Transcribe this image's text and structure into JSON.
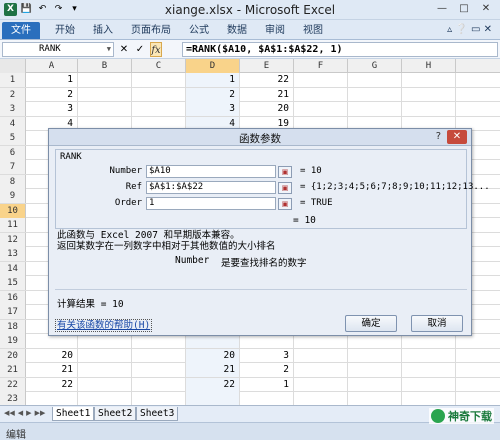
{
  "window": {
    "title": "xiange.xlsx - Microsoft Excel",
    "quick_access": [
      "X",
      "💾",
      "↶",
      "↷",
      "▾"
    ],
    "controls": [
      "—",
      "□",
      "✕"
    ]
  },
  "ribbon": {
    "tabs": [
      "文件",
      "开始",
      "插入",
      "页面布局",
      "公式",
      "数据",
      "审阅",
      "视图"
    ],
    "help": "▵ ❔ ▭ ✕"
  },
  "formula_bar": {
    "name_box": "RANK",
    "cancel": "✕",
    "enter": "✓",
    "fx": "fx",
    "formula": "=RANK($A10, $A$1:$A$22, 1)"
  },
  "columns": [
    "A",
    "B",
    "C",
    "D",
    "E",
    "F",
    "G",
    "H"
  ],
  "selected_column": "D",
  "selected_row": "10",
  "rows": [
    {
      "n": "1",
      "a": "1",
      "d": "1",
      "e": "22"
    },
    {
      "n": "2",
      "a": "2",
      "d": "2",
      "e": "21"
    },
    {
      "n": "3",
      "a": "3",
      "d": "3",
      "e": "20"
    },
    {
      "n": "4",
      "a": "4",
      "d": "4",
      "e": "19"
    },
    {
      "n": "5",
      "a": "",
      "d": "",
      "e": ""
    },
    {
      "n": "6",
      "a": "",
      "d": "",
      "e": ""
    },
    {
      "n": "7",
      "a": "",
      "d": "",
      "e": ""
    },
    {
      "n": "8",
      "a": "",
      "d": "",
      "e": ""
    },
    {
      "n": "9",
      "a": "",
      "d": "",
      "e": ""
    },
    {
      "n": "10",
      "a": "",
      "d": "",
      "e": ""
    },
    {
      "n": "11",
      "a": "",
      "d": "",
      "e": ""
    },
    {
      "n": "12",
      "a": "",
      "d": "",
      "e": ""
    },
    {
      "n": "13",
      "a": "",
      "d": "",
      "e": ""
    },
    {
      "n": "14",
      "a": "",
      "d": "",
      "e": ""
    },
    {
      "n": "15",
      "a": "",
      "d": "",
      "e": ""
    },
    {
      "n": "16",
      "a": "",
      "d": "",
      "e": ""
    },
    {
      "n": "17",
      "a": "",
      "d": "",
      "e": ""
    },
    {
      "n": "18",
      "a": "",
      "d": "",
      "e": ""
    },
    {
      "n": "19",
      "a": "",
      "d": "",
      "e": ""
    },
    {
      "n": "20",
      "a": "20",
      "d": "20",
      "e": "3"
    },
    {
      "n": "21",
      "a": "21",
      "d": "21",
      "e": "2"
    },
    {
      "n": "22",
      "a": "22",
      "d": "22",
      "e": "1"
    },
    {
      "n": "23",
      "a": "",
      "d": "",
      "e": ""
    }
  ],
  "sheets": [
    "Sheet1",
    "Sheet2",
    "Sheet3"
  ],
  "status": "编辑",
  "watermark": "神奇下载",
  "dialog": {
    "title": "函数参数",
    "help": "?",
    "close": "✕",
    "function_name": "RANK",
    "args": [
      {
        "label": "Number",
        "value": "$A10",
        "result": "= 10"
      },
      {
        "label": "Ref",
        "value": "$A$1:$A$22",
        "result": "= {1;2;3;4;5;6;7;8;9;10;11;12;13..."
      },
      {
        "label": "Order",
        "value": "1",
        "result": "= TRUE"
      }
    ],
    "overall_result": "= 10",
    "description_1": "此函数与 Excel 2007 和早期版本兼容。",
    "description_2": "返回某数字在一列数字中相对于其他数值的大小排名",
    "arg_help_name": "Number",
    "arg_help_text": "是要查找排名的数字",
    "calc_result": "计算结果 = 10",
    "help_link": "有关该函数的帮助(H)",
    "ok": "确定",
    "cancel": "取消"
  }
}
